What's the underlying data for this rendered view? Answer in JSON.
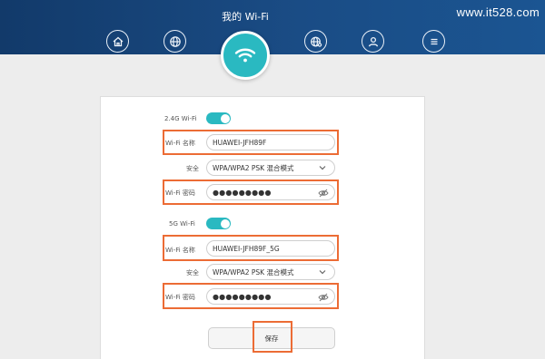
{
  "header": {
    "title": "我的 Wi-Fi",
    "watermark": "www.it528.com",
    "nav_icons": [
      "home-icon",
      "globe-icon",
      "wifi-icon",
      "globe-settings-icon",
      "user-icon",
      "menu-icon"
    ],
    "accent_color": "#2ab9c1"
  },
  "band_24": {
    "band_label": "2.4G Wi-Fi",
    "enabled": true,
    "name_label": "Wi-Fi 名称",
    "name_value": "HUAWEI-JFH89F",
    "security_label": "安全",
    "security_value": "WPA/WPA2 PSK 混合模式",
    "password_label": "Wi-Fi 密码",
    "password_value": "●●●●●●●●●"
  },
  "band_5": {
    "band_label": "5G Wi-Fi",
    "enabled": true,
    "name_label": "Wi-Fi 名称",
    "name_value": "HUAWEI-JFH89F_5G",
    "security_label": "安全",
    "security_value": "WPA/WPA2 PSK 混合模式",
    "password_label": "Wi-Fi 密码",
    "password_value": "●●●●●●●●●"
  },
  "save_label": "保存",
  "highlight_color": "#ec6c35"
}
